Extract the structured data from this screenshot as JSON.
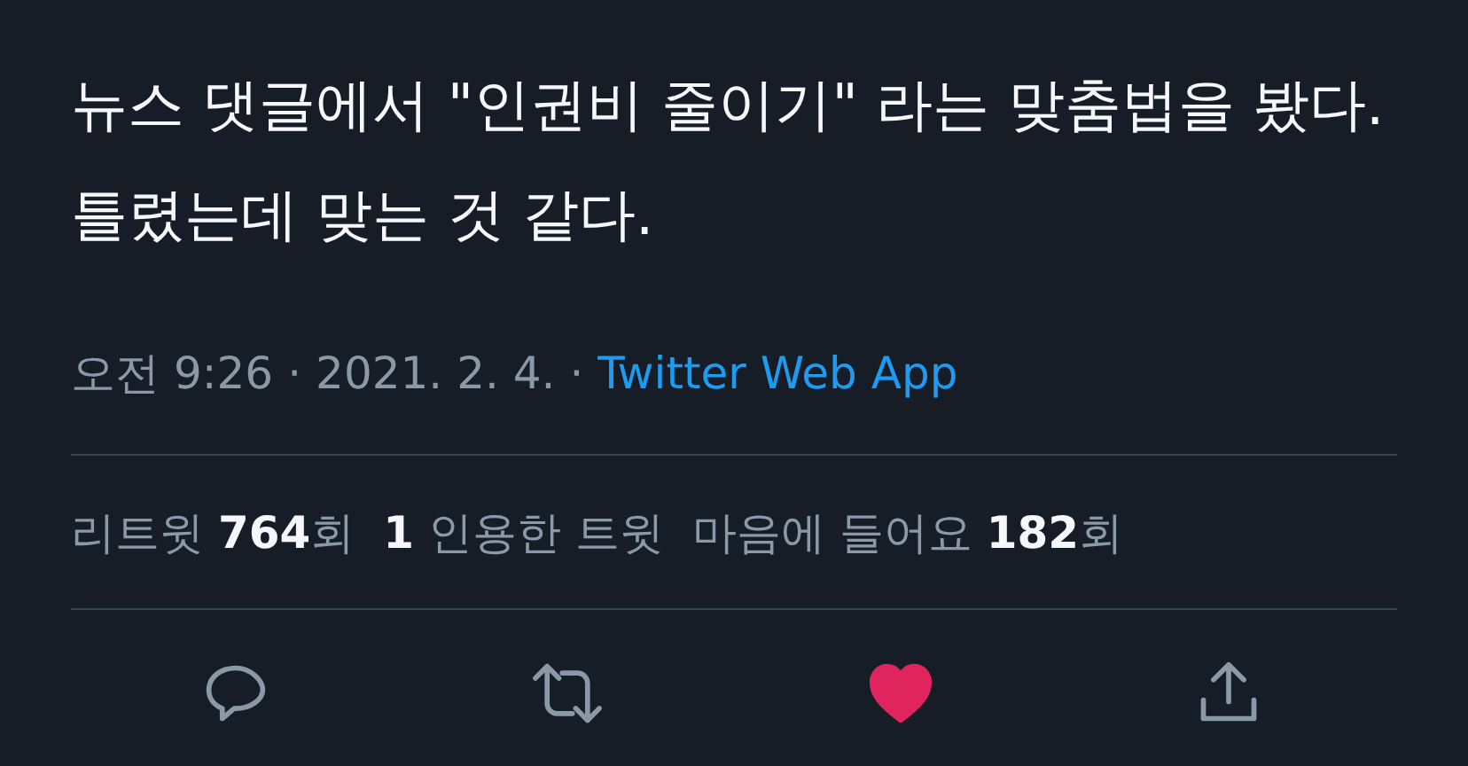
{
  "tweet": {
    "text": "뉴스 댓글에서 \"인권비 줄이기\" 라는 맞춤법을 봤다. 틀렸는데 맞는 것 같다.",
    "meta": [
      {
        "kind": "time",
        "text": "오전 9:26"
      },
      {
        "kind": "separator",
        "text": "·"
      },
      {
        "kind": "date",
        "text": "2021. 2. 4."
      },
      {
        "kind": "separator",
        "text": "·"
      },
      {
        "kind": "source",
        "text": "Twitter Web App"
      }
    ]
  },
  "stats": [
    "리트윗 **764**회",
    "**1** 인용한 트윗",
    "마음에 들어요 **182**회"
  ],
  "actions": [
    {
      "kind": "reply"
    },
    {
      "kind": "retweet"
    },
    {
      "kind": "like",
      "liked": true
    },
    {
      "kind": "share"
    }
  ]
}
